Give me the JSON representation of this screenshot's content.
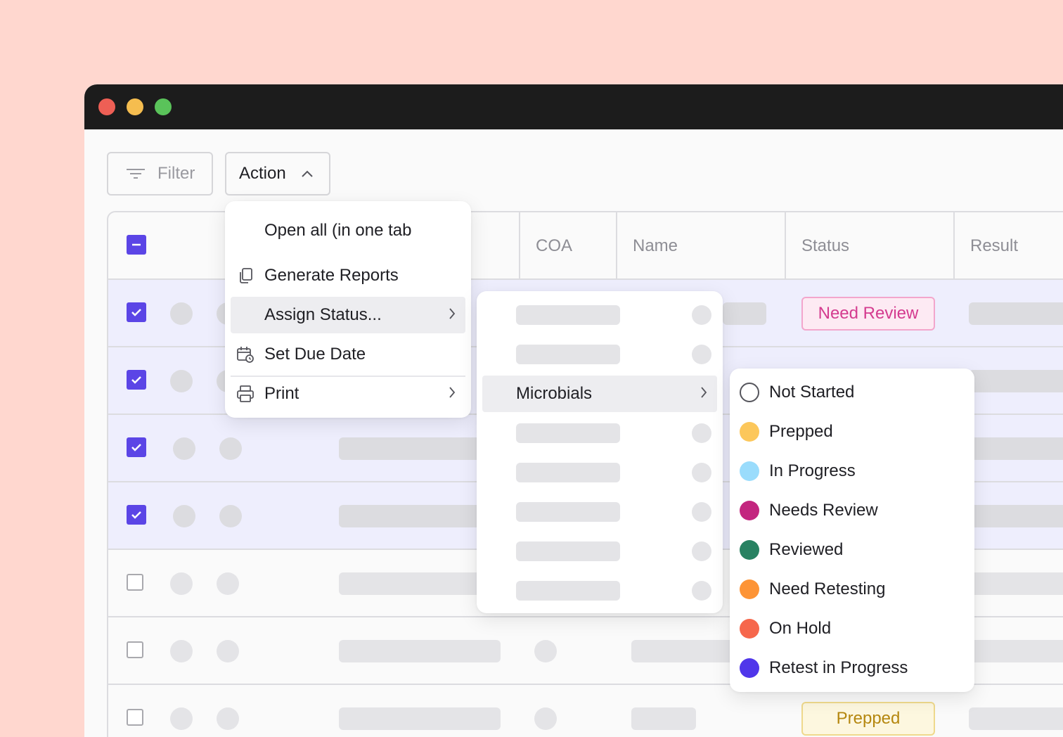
{
  "toolbar": {
    "filter_label": "Filter",
    "action_label": "Action"
  },
  "table": {
    "columns": [
      "COA",
      "Name",
      "Status",
      "Result"
    ],
    "badges": {
      "row1": {
        "label": "Need Review",
        "color": "#d43b8f",
        "bg": "#fdeaf3",
        "border": "#f3a6cc"
      },
      "row7": {
        "label": "Prepped",
        "color": "#b5870f",
        "bg": "#fdf7df",
        "border": "#efd98c"
      }
    }
  },
  "action_menu": {
    "items": [
      {
        "label": "Open all (in one tab",
        "icon": ""
      },
      {
        "label": "Generate Reports",
        "icon": "copy-icon"
      },
      {
        "label": "Assign Status...",
        "icon": "",
        "submenu": true
      },
      {
        "label": "Set Due Date",
        "icon": "calendar-clock-icon"
      },
      {
        "label": "Print",
        "icon": "printer-icon",
        "submenu": true
      }
    ]
  },
  "category_menu": {
    "selected": "Microbials"
  },
  "status_menu": {
    "items": [
      {
        "label": "Not Started",
        "color": ""
      },
      {
        "label": "Prepped",
        "color": "#fcc75b"
      },
      {
        "label": "In Progress",
        "color": "#9adcfc"
      },
      {
        "label": "Needs Review",
        "color": "#c3267f"
      },
      {
        "label": "Reviewed",
        "color": "#288262"
      },
      {
        "label": "Need Retesting",
        "color": "#fd9436"
      },
      {
        "label": "On Hold",
        "color": "#f6674c"
      },
      {
        "label": "Retest in Progress",
        "color": "#5036ea"
      }
    ]
  },
  "colors": {
    "accent": "#5b45e6",
    "selected_row": "#eeeefd"
  }
}
